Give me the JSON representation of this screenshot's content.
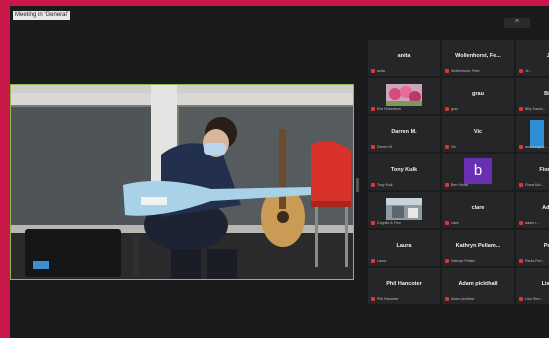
{
  "window": {
    "caption": "Meeting in 'General'",
    "collapse_glyph": "^"
  },
  "colors": {
    "brand_background": "#c8184a",
    "stage_background": "#1b1b1d",
    "speaker_border": "#8fbf4a",
    "mic_muted": "#e0342c",
    "avatar_purple": "#6a2fb3"
  },
  "participants": [
    {
      "name": "anita",
      "foot": "anita",
      "kind": "text"
    },
    {
      "name": "Wollenhorst, Fe...",
      "foot": "Wollenhorst, Felix",
      "kind": "text"
    },
    {
      "name": "Je...",
      "foot": "Je...",
      "kind": "text"
    },
    {
      "name": "",
      "foot": "Eve Robertson",
      "kind": "photo-flowers"
    },
    {
      "name": "grau",
      "foot": "grau",
      "kind": "text"
    },
    {
      "name": "Billy...",
      "foot": "Billy Eastm...",
      "kind": "text"
    },
    {
      "name": "Darren M.",
      "foot": "Darren M.",
      "kind": "text"
    },
    {
      "name": "Vic",
      "foot": "Vic",
      "kind": "text"
    },
    {
      "name": "",
      "foot": "andreasgeis...",
      "kind": "blue"
    },
    {
      "name": "Tony Kulk",
      "foot": "Tony Kulk",
      "kind": "text"
    },
    {
      "name": "",
      "foot": "Ben Hewitt",
      "kind": "avatar",
      "letter": "b"
    },
    {
      "name": "Fiona M...",
      "foot": "Fiona Mol...",
      "kind": "text"
    },
    {
      "name": "",
      "foot": "Cognito & Finn",
      "kind": "photo-room"
    },
    {
      "name": "clare",
      "foot": "clare",
      "kind": "text"
    },
    {
      "name": "Adam...",
      "foot": "adam r...",
      "kind": "text"
    },
    {
      "name": "Laura",
      "foot": "Laura",
      "kind": "text"
    },
    {
      "name": "Kathryn Pellam...",
      "foot": "Kathryn Pellam",
      "kind": "text"
    },
    {
      "name": "Paul...",
      "foot": "Paula Furl...",
      "kind": "text"
    },
    {
      "name": "Phil Hancoter",
      "foot": "Phil Hancoter",
      "kind": "text"
    },
    {
      "name": "Adam pickthall",
      "foot": "Adam pickthall",
      "kind": "text"
    },
    {
      "name": "Lisa S...",
      "foot": "Lisa Sten...",
      "kind": "text"
    }
  ]
}
